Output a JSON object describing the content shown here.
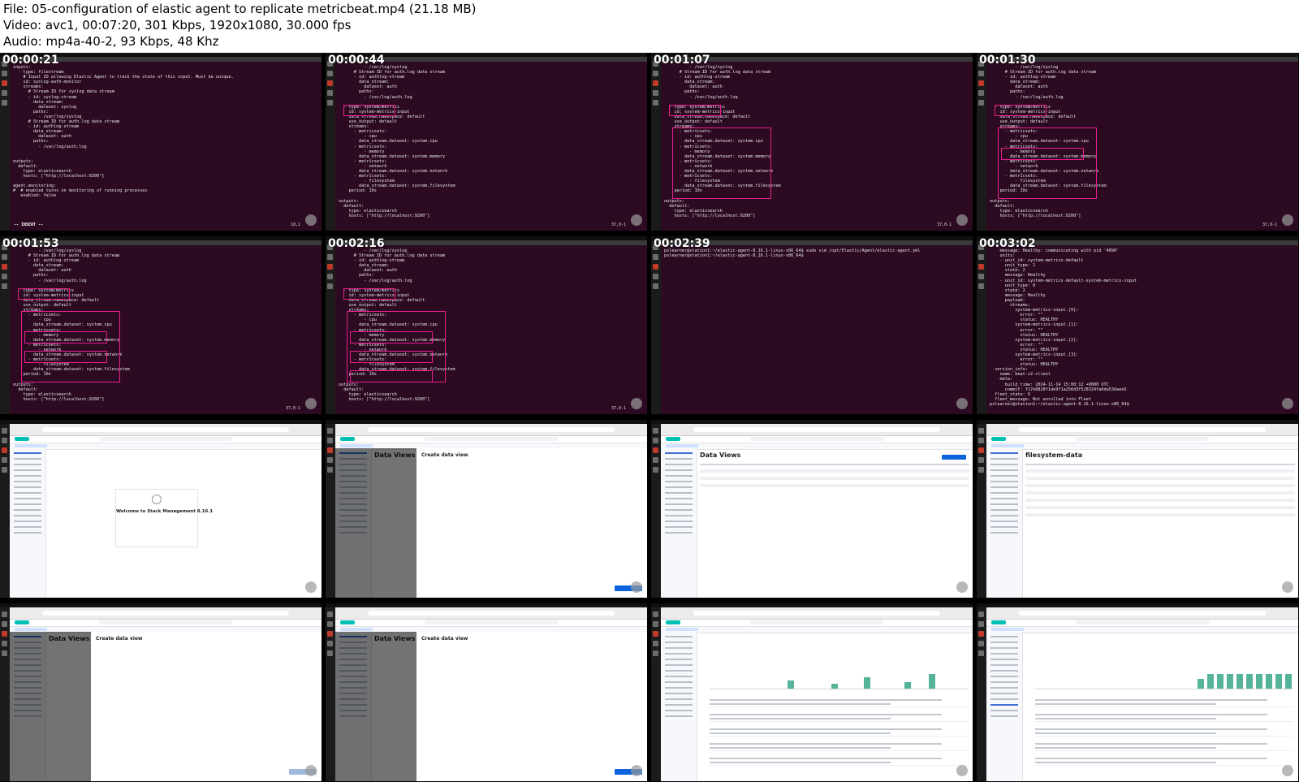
{
  "header": {
    "file_line": "File: 05-configuration of elastic agent to replicate metricbeat.mp4 (21.18 MB)",
    "video_line": "Video: avc1, 00:07:20, 301 Kbps, 1920x1080, 30.000 fps",
    "audio_line": "Audio: mp4a-40-2, 93 Kbps, 48 Khz"
  },
  "thumbnails": [
    {
      "timestamp": "00:00:21"
    },
    {
      "timestamp": "00:00:44"
    },
    {
      "timestamp": "00:01:07"
    },
    {
      "timestamp": "00:01:30"
    },
    {
      "timestamp": "00:01:53"
    },
    {
      "timestamp": "00:02:16"
    },
    {
      "timestamp": "00:02:39"
    },
    {
      "timestamp": "00:03:02"
    },
    {
      "timestamp": ""
    },
    {
      "timestamp": ""
    },
    {
      "timestamp": ""
    },
    {
      "timestamp": ""
    },
    {
      "timestamp": ""
    },
    {
      "timestamp": ""
    },
    {
      "timestamp": ""
    },
    {
      "timestamp": ""
    }
  ],
  "terminal": {
    "code_inputs": "inputs:\n  - type: filestream\n    # Input ID allowing Elastic Agent to track the state of this input. Must be unique.\n    id: syslog-auth-monitor\n    streams:\n      # Stream ID for syslog data stream\n      - id: syslog-stream\n        data_stream:\n          dataset: syslog\n        paths:\n          - /var/log/syslog\n      # Stream ID for auth.log data stream\n      - id: authlog-stream\n        data_stream:\n          dataset: auth\n        paths:\n          - /var/log/auth.log\n\n\noutputs:\n  default:\n    type: elasticsearch\n    hosts: [\"http://localhost:9200\"]\n\nagent.monitoring:\n#  # enabled turns on monitoring of running processes\n   enabled: false",
    "code_metrics": "          - /var/log/syslog\n      # Stream ID for auth.log data stream\n      - id: authlog-stream\n        data_stream:\n          dataset: auth\n        paths:\n          - /var/log/auth.log\n\n  - type: system/metrics\n    id: system-metrics-input\n    data_stream.namespace: default\n    use_output: default\n    streams:\n      - metricsets:\n          - cpu\n        data_stream.dataset: system.cpu\n      - metricsets:\n          - memory\n        data_stream.dataset: system.memory\n      - metricsets:\n          - network\n        data_stream.dataset: system.network\n      - metricsets:\n          - filesystem\n        data_stream.dataset: system.filesystem\n    period: 10s\n\noutputs:\n  default:\n    type: elasticsearch\n    hosts: [\"http://localhost:9200\"]",
    "code_shell": "pslearner@station1:~/elastic-agent-8.16.1-linux-x86_64$ sudo vim /opt/Elastic/Agent/elastic-agent.yml\npslearner@station1:~/elastic-agent-8.16.1-linux-x86_64$",
    "code_status": "    message: Healthy: communicating with pid '4890'\n    units:\n    - unit_id: system-metrics-default\n      unit_type: 1\n      state: 2\n      message: Healthy\n    - unit_id: system-metrics-default-system-metrics-input\n      unit_type: 0\n      state: 2\n      message: Healthy\n      payload:\n        streams:\n          system-metrics-input.[0]:\n            error: \"\"\n            status: HEALTHY\n          system-metrics-input.[1]:\n            error: \"\"\n            status: HEALTHY\n          system-metrics-input.[2]:\n            error: \"\"\n            status: HEALTHY\n          system-metrics-input.[3]:\n            error: \"\"\n            status: HEALTHY\n  version_info:\n    name: beat-v2-client\n    meta:\n      build_time: 2024-11-14 15:00:12 +0000 UTC\n      commit: f17e0828f1de9f1a256d3f528324fa6da53daee5\n  fleet_state: 6\n  fleet_message: Not enrolled into Fleet\npslearner@station1:~/elastic-agent-8.16.1-linux-x86_64$",
    "mode_insert": "-- INSERT --",
    "pos_a": "18,1",
    "pos_b": "37,0-1",
    "pct": "All",
    "pct_b": "66%"
  },
  "kibana": {
    "welcome_title": "Welcome to Stack Management 8.16.1",
    "create_data_view": "Create data view",
    "data_views": "Data Views",
    "index_name": "filesystem-data"
  },
  "colors": {
    "terminal_bg": "#2c0a22",
    "highlight": "#e91e8c",
    "elastic_teal": "#00bfb3",
    "kibana_blue": "#0b64dd",
    "histogram_green": "#54b399"
  }
}
